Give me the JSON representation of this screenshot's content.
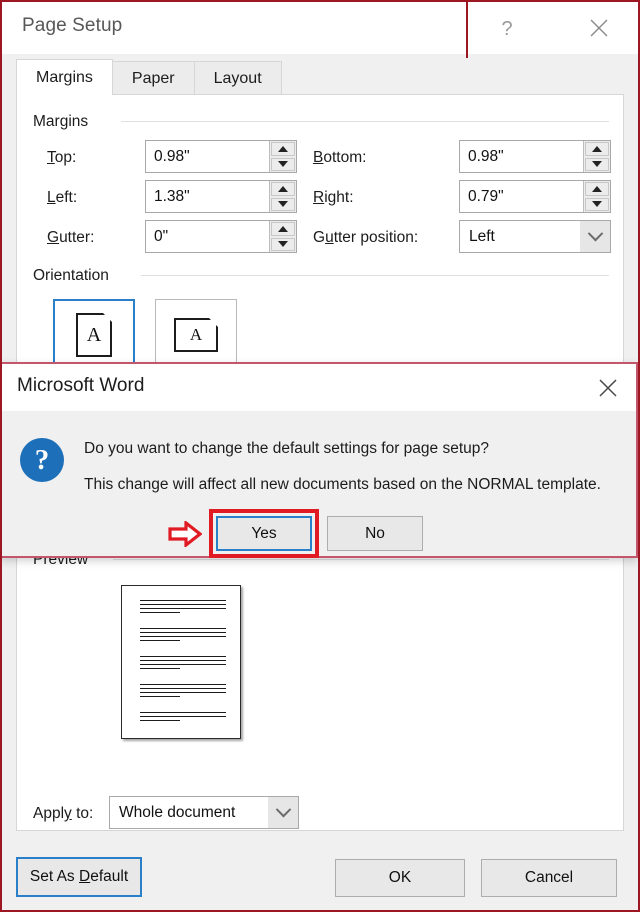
{
  "window": {
    "title": "Page Setup",
    "help_icon": "question-mark-icon",
    "close_icon": "close-icon"
  },
  "tabs": [
    {
      "label": "Margins",
      "active": true
    },
    {
      "label": "Paper",
      "active": false
    },
    {
      "label": "Layout",
      "active": false
    }
  ],
  "margins_group": {
    "legend": "Margins",
    "fields": [
      {
        "label": "Top:",
        "accel": "T",
        "value": "0.98\""
      },
      {
        "label": "Bottom:",
        "accel": "B",
        "value": "0.98\""
      },
      {
        "label": "Left:",
        "accel": "L",
        "value": "1.38\""
      },
      {
        "label": "Right:",
        "accel": "R",
        "value": "0.79\""
      },
      {
        "label": "Gutter:",
        "accel": "G",
        "value": "0\""
      }
    ],
    "gutter_position": {
      "label_pre": "G",
      "label_accel": "u",
      "label_post": "tter position:",
      "value": "Left"
    }
  },
  "orientation_group": {
    "legend": "Orientation",
    "options": [
      {
        "name": "Portrait",
        "selected": true
      },
      {
        "name": "Landscape",
        "selected": false
      }
    ]
  },
  "preview_group": {
    "legend": "Preview"
  },
  "apply_to": {
    "label_pre": "Appl",
    "label_accel": "y",
    "label_post": " to:",
    "value": "Whole document"
  },
  "footer_buttons": {
    "set_as_default_pre": "Set As ",
    "set_as_default_accel": "D",
    "set_as_default_post": "efault",
    "ok": "OK",
    "cancel": "Cancel"
  },
  "message_box": {
    "title": "Microsoft Word",
    "close_icon": "close-icon",
    "icon": "question-circle-icon",
    "line1": "Do you want to change the default settings for page setup?",
    "line2": "This change will affect all new documents based on the NORMAL template.",
    "yes_label": "Yes",
    "no_label": "No"
  },
  "annotation": {
    "arrow_icon": "red-arrow-right-icon",
    "highlight_color": "#e01b24",
    "frame_color": "#9c1722"
  }
}
